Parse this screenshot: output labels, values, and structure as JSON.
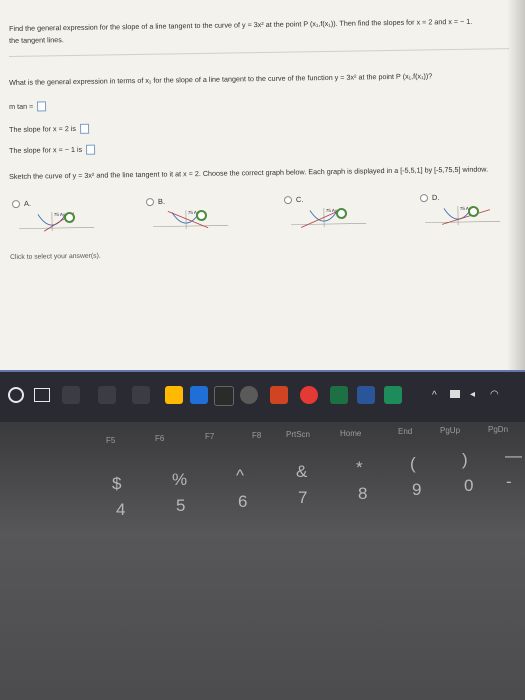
{
  "question": {
    "line1": "Find the general expression for the slope of a line tangent to the curve of y = 3x² at the point P (x₁,f(x₁)). Then find the slopes for x = 2 and x = − 1.",
    "line2": "the tangent lines.",
    "line3": "What is the general expression in terms of x₁ for the slope of a line tangent to the curve of the function y = 3x² at the point P (x₁,f(x₁))?",
    "mtan_label": "m tan =",
    "slope_x2": "The slope for x = 2 is",
    "slope_xm1": "The slope for x = − 1 is",
    "sketch": "Sketch the curve of y = 3x² and the line tangent to it at x = 2. Choose the correct graph below. Each graph is displayed in a [-5,5,1] by [-5,75,5] window.",
    "options": [
      "A.",
      "B.",
      "C.",
      "D."
    ],
    "click_hint": "Click to select your answer(s).",
    "graph_label": "75 Ay"
  },
  "colors": {
    "screen_bg": "#f4f2ec",
    "taskbar_bg": "#2a2a32",
    "magnifier": "#4c8c3c"
  },
  "keyboard": {
    "fn_keys": [
      "F5",
      "F6",
      "F7",
      "F8",
      "PrtScn",
      "Home",
      "End",
      "PgUp",
      "PgDn"
    ],
    "number_keys": [
      "$",
      "%",
      "^",
      "&",
      "*",
      "(",
      ")",
      "—"
    ],
    "digit_keys": [
      "4",
      "5",
      "6",
      "7",
      "8",
      "9",
      "0",
      "-"
    ]
  }
}
